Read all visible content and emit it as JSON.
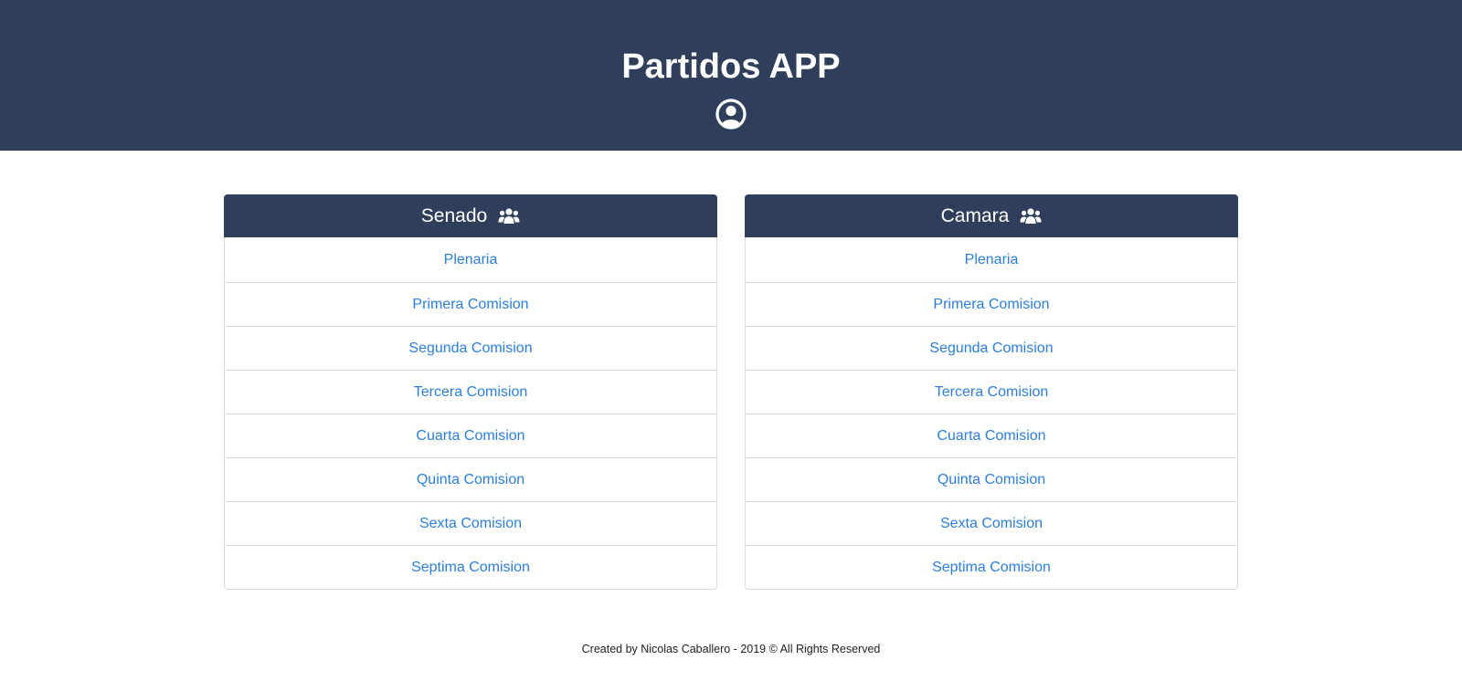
{
  "header": {
    "title": "Partidos APP",
    "user_icon": "user-circle-icon",
    "background_color": "#2f3f5b"
  },
  "senado": {
    "title": "Senado",
    "icon": "users-icon",
    "items": [
      "Plenaria",
      "Primera Comision",
      "Segunda Comision",
      "Tercera Comision",
      "Cuarta Comision",
      "Quinta Comision",
      "Sexta Comision",
      "Septima Comision"
    ]
  },
  "camara": {
    "title": "Camara",
    "icon": "users-icon",
    "items": [
      "Plenaria",
      "Primera Comision",
      "Segunda Comision",
      "Tercera Comision",
      "Cuarta Comision",
      "Quinta Comision",
      "Sexta Comision",
      "Septima Comision"
    ]
  },
  "footer": {
    "text": "Created by Nicolas Caballero - 2019 © All Rights Reserved"
  },
  "colors": {
    "link": "#2a7de1",
    "border": "#dcdcdc"
  }
}
